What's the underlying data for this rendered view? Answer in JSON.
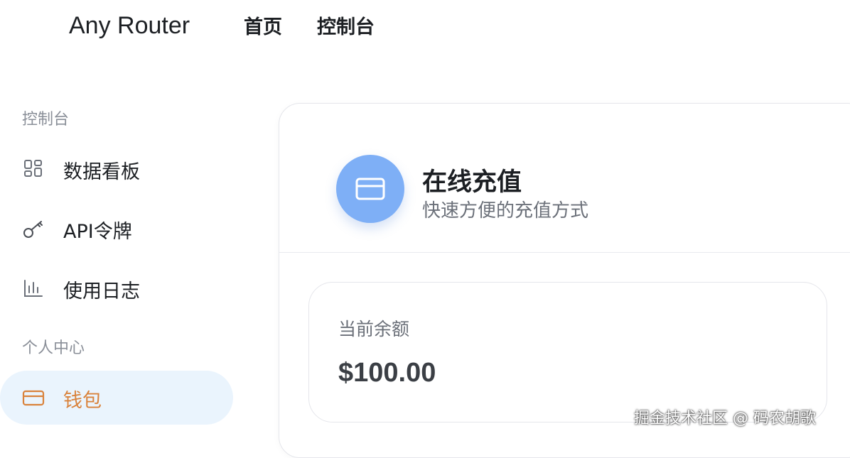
{
  "app": {
    "brand": "Any Router"
  },
  "header": {
    "nav": [
      {
        "label": "首页"
      },
      {
        "label": "控制台"
      }
    ]
  },
  "sidebar": {
    "sections": [
      {
        "label": "控制台",
        "items": [
          {
            "label": "数据看板",
            "icon": "dashboard-grid-icon"
          },
          {
            "label": "API令牌",
            "icon": "key-icon"
          },
          {
            "label": "使用日志",
            "icon": "bar-chart-icon"
          }
        ]
      },
      {
        "label": "个人中心",
        "items": [
          {
            "label": "钱包",
            "icon": "credit-card-icon",
            "active": true
          }
        ]
      }
    ]
  },
  "main": {
    "title": "在线充值",
    "subtitle": "快速方便的充值方式",
    "balance": {
      "label": "当前余额",
      "value": "$100.00"
    }
  },
  "watermark": "掘金技术社区 @ 码农胡歌",
  "colors": {
    "accent": "#7eaff6",
    "active_text": "#d9823b",
    "active_bg": "#eaf4fd"
  }
}
